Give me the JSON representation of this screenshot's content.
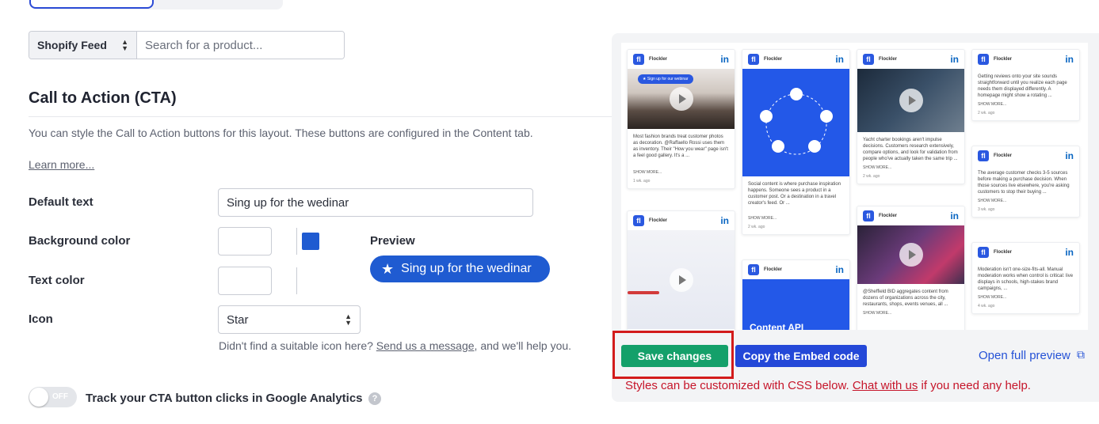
{
  "feed": {
    "select_value": "Shopify Feed",
    "search_placeholder": "Search for a product..."
  },
  "cta": {
    "title": "Call to Action (CTA)",
    "description": "You can style the Call to Action buttons for this layout. These buttons are configured in the Content tab.",
    "learn_more": "Learn more...",
    "default_text_label": "Default text",
    "default_text_value": "Sing up for the wedinar",
    "background_color_label": "Background color",
    "background_swatch_color": "#1f5bd1",
    "text_color_label": "Text color",
    "preview_label": "Preview",
    "preview_button_text": "Sing up for the wedinar",
    "preview_button_color": "#1f5bd1",
    "icon_label": "Icon",
    "icon_value": "Star",
    "icon_glyph": "star-icon",
    "helper_prefix": "Didn't find a suitable icon here?",
    "helper_link": "Send us a message",
    "helper_suffix": ", and we'll help you.",
    "analytics_toggle_state": "OFF",
    "analytics_label": "Track your CTA button clicks in Google Analytics"
  },
  "preview_wall": {
    "brand": "Flockler",
    "network_icon": "linkedin-icon",
    "cards": [
      {
        "chip": "Sign up for our webinar",
        "text": "Most fashion brands treat customer photos as decoration. @Raffaello Rossi uses them as inventory. Their \"How you wear\" page isn't a feel good gallery. It's a ...",
        "more": "SHOW MORE...",
        "ago": "1 wk. ago"
      },
      {
        "text": "Social content is where purchase inspiration happens. Someone sees a product in a customer post. Or a destination in a travel creator's feed. Or ...",
        "more": "SHOW MORE...",
        "ago": "2 wk. ago"
      },
      {
        "text": "Yacht charter bookings aren't impulse decisions. Customers research extensively, compare options, and look for validation from people who've actually taken the same trip ...",
        "more": "SHOW MORE...",
        "ago": "2 wk. ago"
      },
      {
        "text": "Getting reviews onto your site sounds straightforward until you realize each page needs them displayed differently. A homepage might show a rotating ...",
        "more": "SHOW MORE...",
        "ago": "2 wk. ago"
      },
      {
        "text": "The average customer checks 3-5 sources before making a purchase decision. When those sources live elsewhere, you're asking customers to stop their buying ...",
        "more": "SHOW MORE...",
        "ago": "3 wk. ago"
      },
      {
        "text": "Moderation isn't one-size-fits-all. Manual moderation works when control is critical: live displays in schools, high-stakes brand campaigns, ...",
        "more": "SHOW MORE...",
        "ago": "4 wk. ago"
      },
      {
        "text": "@Sheffield BID aggregates content from dozens of organizations across the city, restaurants, shops, events venues, all ...",
        "more": "SHOW MORE..."
      },
      {
        "media_text": "Content API"
      }
    ]
  },
  "actions": {
    "save_label": "Save changes",
    "save_color": "#14a06a",
    "embed_label": "Copy the Embed code",
    "embed_color": "#2448d8",
    "full_preview_label": "Open full preview",
    "css_note_prefix": "Styles can be customized with CSS below.",
    "css_note_link": "Chat with us",
    "css_note_suffix": "if you need any help."
  }
}
